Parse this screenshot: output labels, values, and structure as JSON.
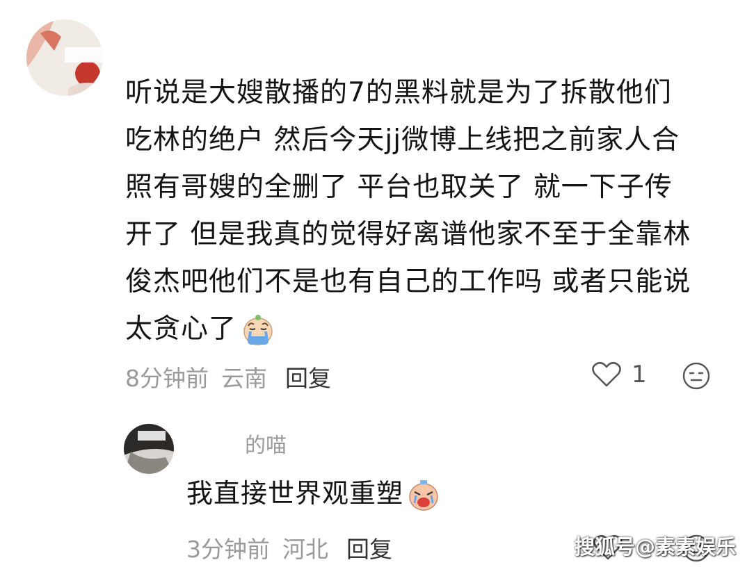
{
  "comments": [
    {
      "username": "",
      "avatar_icon": "user-avatar",
      "lines": [
        "听说是大嫂散播的7的黑料就是为了拆散他们",
        "吃林的绝户 然后今天jj微博上线把之前家人合",
        "照有哥嫂的全删了 平台也取关了 就一下子传",
        "开了 但是我真的觉得好离谱他家不至于全靠林",
        "俊杰吧他们不是也有自己的工作吗 或者只能说",
        "太贪心了"
      ],
      "emoji": "crying-emoji",
      "time": "8分钟前",
      "location": "云南",
      "reply_label": "回复",
      "like_count": "1"
    },
    {
      "username": "的喵",
      "avatar_icon": "user-avatar",
      "text": "我直接世界观重塑",
      "emoji": "sobbing-emoji",
      "time": "3分钟前",
      "location": "河北",
      "reply_label": "回复"
    }
  ],
  "watermark": "搜狐号@素素娱乐",
  "colors": {
    "background": "#ffffff",
    "text": "#141414",
    "meta": "#9a9a9a",
    "reply": "#333333"
  }
}
